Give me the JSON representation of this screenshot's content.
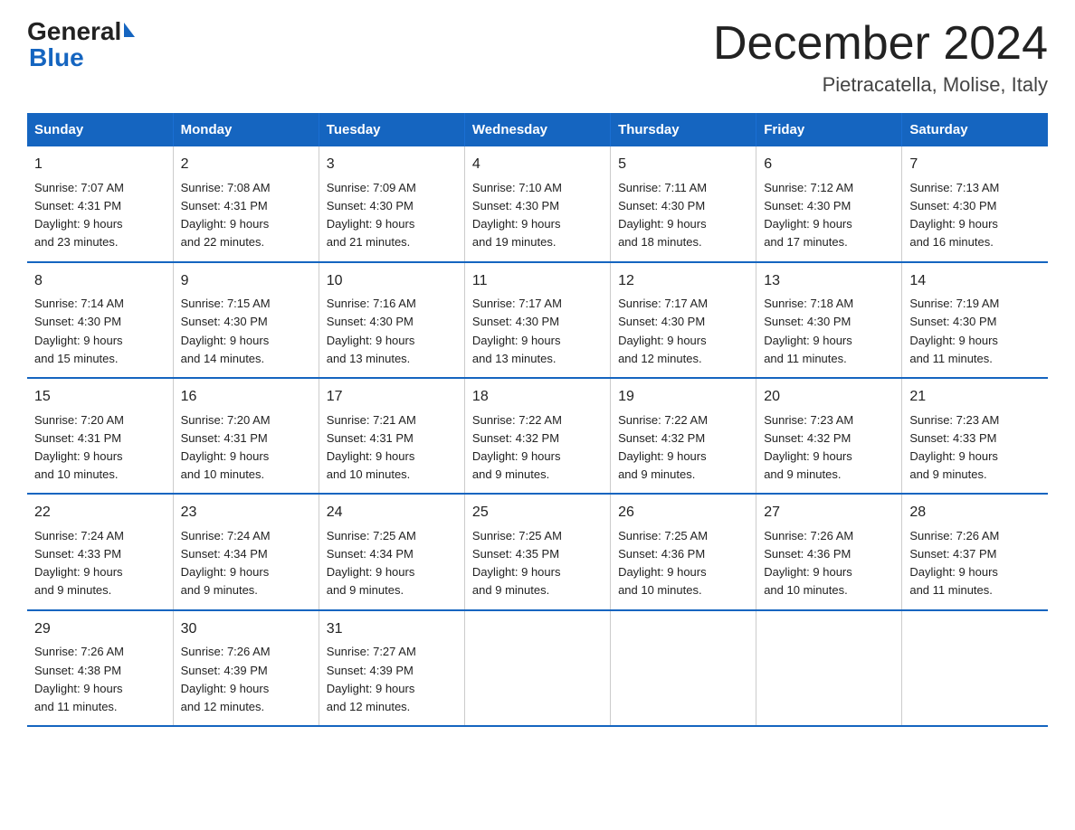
{
  "logo": {
    "general": "General",
    "blue": "Blue",
    "triangle": "▶"
  },
  "title": "December 2024",
  "subtitle": "Pietracatella, Molise, Italy",
  "days_of_week": [
    "Sunday",
    "Monday",
    "Tuesday",
    "Wednesday",
    "Thursday",
    "Friday",
    "Saturday"
  ],
  "weeks": [
    [
      {
        "day": "1",
        "sunrise": "7:07 AM",
        "sunset": "4:31 PM",
        "daylight": "9 hours and 23 minutes."
      },
      {
        "day": "2",
        "sunrise": "7:08 AM",
        "sunset": "4:31 PM",
        "daylight": "9 hours and 22 minutes."
      },
      {
        "day": "3",
        "sunrise": "7:09 AM",
        "sunset": "4:30 PM",
        "daylight": "9 hours and 21 minutes."
      },
      {
        "day": "4",
        "sunrise": "7:10 AM",
        "sunset": "4:30 PM",
        "daylight": "9 hours and 19 minutes."
      },
      {
        "day": "5",
        "sunrise": "7:11 AM",
        "sunset": "4:30 PM",
        "daylight": "9 hours and 18 minutes."
      },
      {
        "day": "6",
        "sunrise": "7:12 AM",
        "sunset": "4:30 PM",
        "daylight": "9 hours and 17 minutes."
      },
      {
        "day": "7",
        "sunrise": "7:13 AM",
        "sunset": "4:30 PM",
        "daylight": "9 hours and 16 minutes."
      }
    ],
    [
      {
        "day": "8",
        "sunrise": "7:14 AM",
        "sunset": "4:30 PM",
        "daylight": "9 hours and 15 minutes."
      },
      {
        "day": "9",
        "sunrise": "7:15 AM",
        "sunset": "4:30 PM",
        "daylight": "9 hours and 14 minutes."
      },
      {
        "day": "10",
        "sunrise": "7:16 AM",
        "sunset": "4:30 PM",
        "daylight": "9 hours and 13 minutes."
      },
      {
        "day": "11",
        "sunrise": "7:17 AM",
        "sunset": "4:30 PM",
        "daylight": "9 hours and 13 minutes."
      },
      {
        "day": "12",
        "sunrise": "7:17 AM",
        "sunset": "4:30 PM",
        "daylight": "9 hours and 12 minutes."
      },
      {
        "day": "13",
        "sunrise": "7:18 AM",
        "sunset": "4:30 PM",
        "daylight": "9 hours and 11 minutes."
      },
      {
        "day": "14",
        "sunrise": "7:19 AM",
        "sunset": "4:30 PM",
        "daylight": "9 hours and 11 minutes."
      }
    ],
    [
      {
        "day": "15",
        "sunrise": "7:20 AM",
        "sunset": "4:31 PM",
        "daylight": "9 hours and 10 minutes."
      },
      {
        "day": "16",
        "sunrise": "7:20 AM",
        "sunset": "4:31 PM",
        "daylight": "9 hours and 10 minutes."
      },
      {
        "day": "17",
        "sunrise": "7:21 AM",
        "sunset": "4:31 PM",
        "daylight": "9 hours and 10 minutes."
      },
      {
        "day": "18",
        "sunrise": "7:22 AM",
        "sunset": "4:32 PM",
        "daylight": "9 hours and 9 minutes."
      },
      {
        "day": "19",
        "sunrise": "7:22 AM",
        "sunset": "4:32 PM",
        "daylight": "9 hours and 9 minutes."
      },
      {
        "day": "20",
        "sunrise": "7:23 AM",
        "sunset": "4:32 PM",
        "daylight": "9 hours and 9 minutes."
      },
      {
        "day": "21",
        "sunrise": "7:23 AM",
        "sunset": "4:33 PM",
        "daylight": "9 hours and 9 minutes."
      }
    ],
    [
      {
        "day": "22",
        "sunrise": "7:24 AM",
        "sunset": "4:33 PM",
        "daylight": "9 hours and 9 minutes."
      },
      {
        "day": "23",
        "sunrise": "7:24 AM",
        "sunset": "4:34 PM",
        "daylight": "9 hours and 9 minutes."
      },
      {
        "day": "24",
        "sunrise": "7:25 AM",
        "sunset": "4:34 PM",
        "daylight": "9 hours and 9 minutes."
      },
      {
        "day": "25",
        "sunrise": "7:25 AM",
        "sunset": "4:35 PM",
        "daylight": "9 hours and 9 minutes."
      },
      {
        "day": "26",
        "sunrise": "7:25 AM",
        "sunset": "4:36 PM",
        "daylight": "9 hours and 10 minutes."
      },
      {
        "day": "27",
        "sunrise": "7:26 AM",
        "sunset": "4:36 PM",
        "daylight": "9 hours and 10 minutes."
      },
      {
        "day": "28",
        "sunrise": "7:26 AM",
        "sunset": "4:37 PM",
        "daylight": "9 hours and 11 minutes."
      }
    ],
    [
      {
        "day": "29",
        "sunrise": "7:26 AM",
        "sunset": "4:38 PM",
        "daylight": "9 hours and 11 minutes."
      },
      {
        "day": "30",
        "sunrise": "7:26 AM",
        "sunset": "4:39 PM",
        "daylight": "9 hours and 12 minutes."
      },
      {
        "day": "31",
        "sunrise": "7:27 AM",
        "sunset": "4:39 PM",
        "daylight": "9 hours and 12 minutes."
      },
      null,
      null,
      null,
      null
    ]
  ],
  "labels": {
    "sunrise": "Sunrise:",
    "sunset": "Sunset:",
    "daylight": "Daylight:"
  }
}
